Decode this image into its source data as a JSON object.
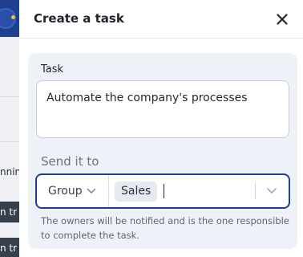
{
  "background": {
    "text_fragments": [
      "nnin",
      "n tr",
      "n tr"
    ]
  },
  "panel": {
    "title": "Create a task",
    "close_icon": "close-icon"
  },
  "form": {
    "task_label": "Task",
    "task_value": "Automate the company's processes",
    "send_label": "Send it to",
    "recipient_type": "Group",
    "selected_chip": "Sales",
    "helper_text": "The owners will be notified and is the one responsible to complete the task."
  },
  "colors": {
    "accent": "#1f3f8f",
    "card_bg": "#eef2f8"
  }
}
